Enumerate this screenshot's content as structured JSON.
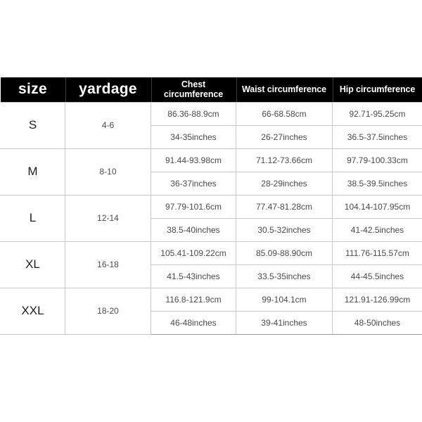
{
  "table": {
    "headers": {
      "size": "size",
      "yardage": "yardage",
      "chest": "Chest circumference",
      "waist": "Waist circumference",
      "hip": "Hip circumference"
    },
    "rows": [
      {
        "size": "S",
        "yardage": "4-6",
        "chest_cm": "86.36-88.9cm",
        "chest_in": "34-35inches",
        "waist_cm": "66-68.58cm",
        "waist_in": "26-27inches",
        "hip_cm": "92.71-95.25cm",
        "hip_in": "36.5-37.5inches"
      },
      {
        "size": "M",
        "yardage": "8-10",
        "chest_cm": "91.44-93.98cm",
        "chest_in": "36-37inches",
        "waist_cm": "71.12-73.66cm",
        "waist_in": "28-29inches",
        "hip_cm": "97.79-100.33cm",
        "hip_in": "38.5-39.5inches"
      },
      {
        "size": "L",
        "yardage": "12-14",
        "chest_cm": "97.79-101.6cm",
        "chest_in": "38.5-40inches",
        "waist_cm": "77.47-81.28cm",
        "waist_in": "30.5-32inches",
        "hip_cm": "104.14-107.95cm",
        "hip_in": "41-42.5inches"
      },
      {
        "size": "XL",
        "yardage": "16-18",
        "chest_cm": "105.41-109.22cm",
        "chest_in": "41.5-43inches",
        "waist_cm": "85.09-88.90cm",
        "waist_in": "33.5-35inches",
        "hip_cm": "111.76-115.57cm",
        "hip_in": "44-45.5inches"
      },
      {
        "size": "XXL",
        "yardage": "18-20",
        "chest_cm": "116.8-121.9cm",
        "chest_in": "46-48inches",
        "waist_cm": "99-104.1cm",
        "waist_in": "39-41inches",
        "hip_cm": "121.91-126.99cm",
        "hip_in": "48-50inches"
      }
    ]
  },
  "colors": {
    "header_background": "#000000",
    "header_text": "#ffffff",
    "body_text": "#3b3b3b",
    "grid_line": "#c8c8c8",
    "page_background": "#ffffff"
  }
}
